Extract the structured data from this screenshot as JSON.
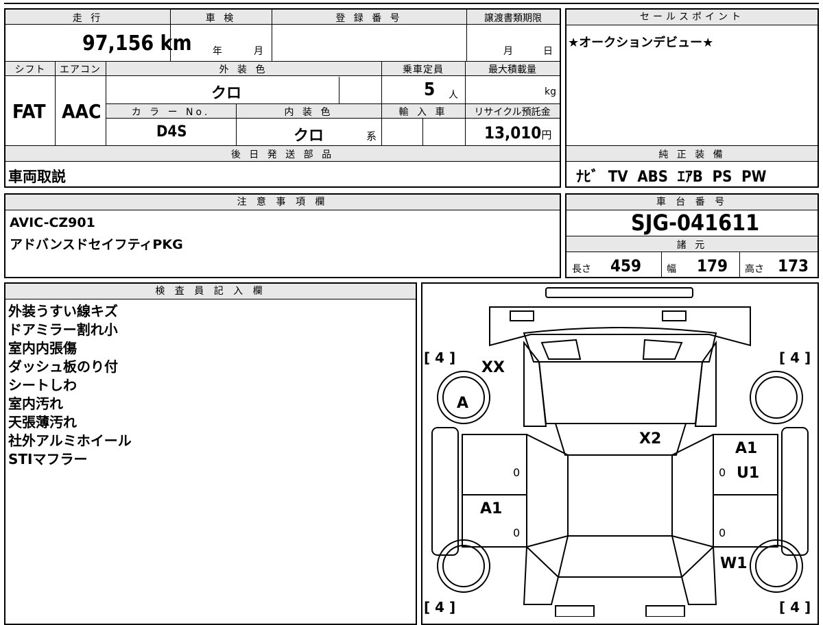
{
  "top_table": {
    "mileage_label": "走 行",
    "mileage_value": "97,156",
    "mileage_unit": "km",
    "inspection_label": "車 検",
    "inspection_year": "年",
    "inspection_month": "月",
    "registration_label": "登 録 番 号",
    "transfer_label": "譲渡書類期限",
    "transfer_month": "月",
    "transfer_day": "日",
    "shift_label": "シフト",
    "ac_label": "エアコン",
    "exterior_color_label": "外 装 色",
    "capacity_label": "乗車定員",
    "max_load_label": "最大積載量",
    "shift_value": "FAT",
    "ac_value": "AAC",
    "exterior_color_value": "クロ",
    "capacity_value": "5",
    "capacity_unit": "人",
    "max_load_unit": "kg",
    "color_no_label": "カ ラ ー No.",
    "interior_color_label": "内 装 色",
    "import_label": "輸 入 車",
    "recycle_label": "リサイクル預託金",
    "color_no_value": "D4S",
    "interior_color_value": "クロ",
    "interior_suffix": "系",
    "recycle_value": "13,010",
    "recycle_unit": "円",
    "later_parts_label": "後 日 発 送 部 品",
    "later_parts_value": "車両取説"
  },
  "sales_point": {
    "label": "セールスポイント",
    "value": "★オークションデビュー★"
  },
  "equipment": {
    "label": "純 正 装 備",
    "value": "ﾅﾋﾞ  TV  ABS  ｴｱB  PS  PW"
  },
  "notes": {
    "label": "注 意 事 項 欄",
    "line1": "AVIC-CZ901",
    "line2": "アドバンスドセイフティPKG"
  },
  "chassis": {
    "label": "車 台 番 号",
    "value": "SJG-041611",
    "spec_label": "諸 元",
    "length_label": "長さ",
    "length_value": "459",
    "width_label": "幅",
    "width_value": "179",
    "height_label": "高さ",
    "height_value": "173"
  },
  "inspector": {
    "label": "検 査 員 記 入 欄",
    "lines": [
      "外装うすい線キズ",
      "ドアミラー割れ小",
      "室内内張傷",
      "ダッシュ板のり付",
      "シートしわ",
      "室内汚れ",
      "天張薄汚れ",
      "社外アルミホイール",
      "STIマフラー"
    ]
  },
  "diagram": {
    "tire_tl": "[ 4 ]",
    "tire_tr": "[ 4 ]",
    "tire_bl": "[ 4 ]",
    "tire_br": "[ 4 ]",
    "mark_xx": "XX",
    "mark_a": "A",
    "mark_x2": "X2",
    "mark_a1_right": "A1",
    "mark_u1": "U1",
    "mark_a1_left": "A1",
    "mark_w1": "W1",
    "zero": "0"
  }
}
